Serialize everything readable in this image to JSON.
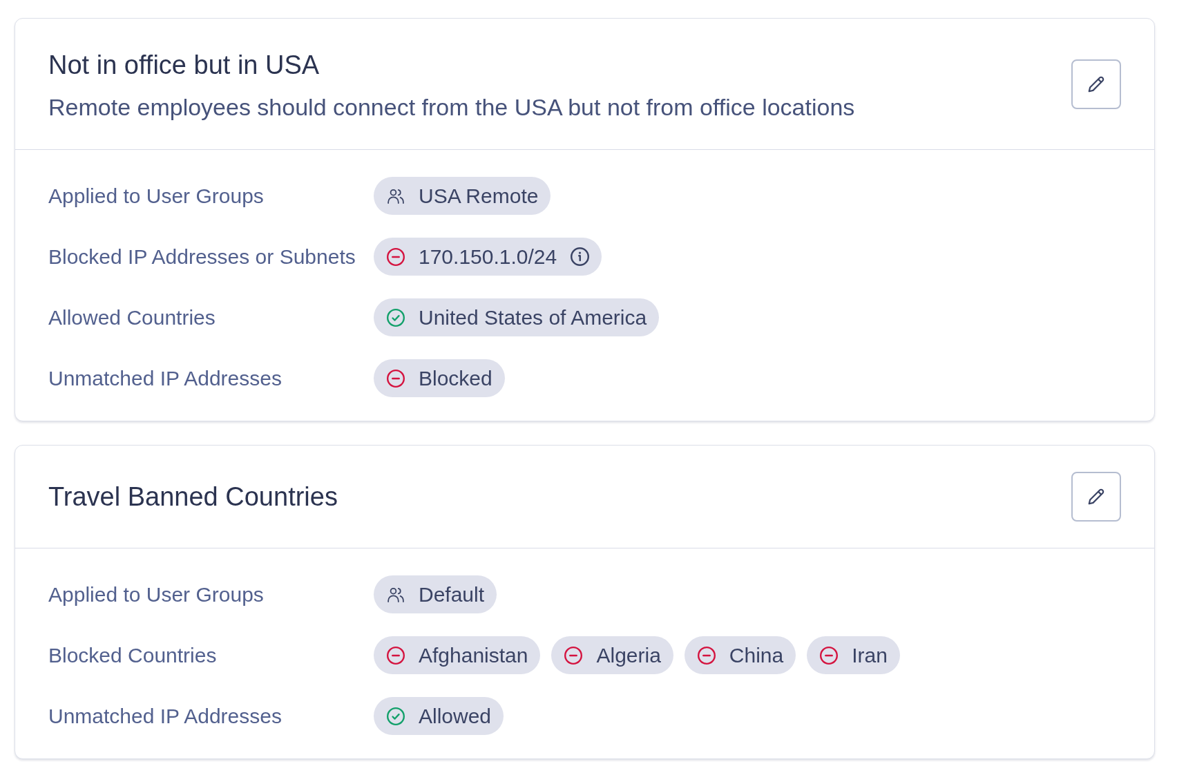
{
  "policies": [
    {
      "title": "Not in office but in USA",
      "description": "Remote employees should connect from the USA but not from office locations",
      "rows": [
        {
          "label": "Applied to User Groups",
          "chips": [
            {
              "kind": "group",
              "text": "USA Remote"
            }
          ]
        },
        {
          "label": "Blocked IP Addresses or Subnets",
          "chips": [
            {
              "kind": "blocked",
              "text": "170.150.1.0/24",
              "info": true
            }
          ]
        },
        {
          "label": "Allowed Countries",
          "chips": [
            {
              "kind": "allowed",
              "text": "United States of America"
            }
          ]
        },
        {
          "label": "Unmatched IP Addresses",
          "chips": [
            {
              "kind": "blocked",
              "text": "Blocked"
            }
          ]
        }
      ]
    },
    {
      "title": "Travel Banned Countries",
      "rows": [
        {
          "label": "Applied to User Groups",
          "chips": [
            {
              "kind": "group",
              "text": "Default"
            }
          ]
        },
        {
          "label": "Blocked Countries",
          "chips": [
            {
              "kind": "blocked",
              "text": "Afghanistan"
            },
            {
              "kind": "blocked",
              "text": "Algeria"
            },
            {
              "kind": "blocked",
              "text": "China"
            },
            {
              "kind": "blocked",
              "text": "Iran"
            }
          ]
        },
        {
          "label": "Unmatched IP Addresses",
          "chips": [
            {
              "kind": "allowed",
              "text": "Allowed"
            }
          ]
        }
      ]
    }
  ]
}
